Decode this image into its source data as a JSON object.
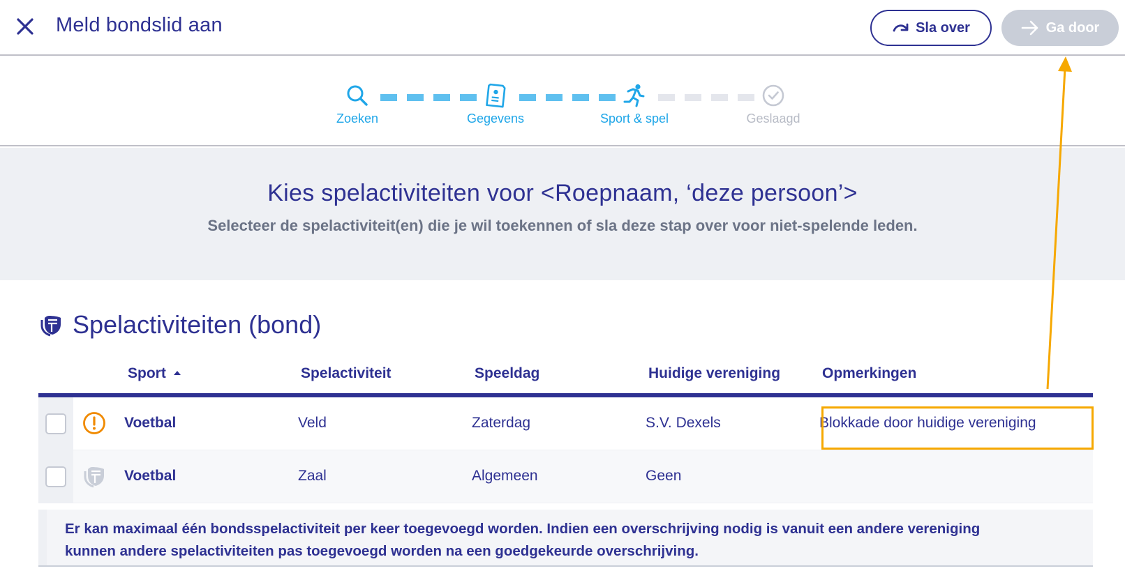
{
  "header": {
    "title": "Meld bondslid aan",
    "skip_label": "Sla over",
    "next_label": "Ga door"
  },
  "stepper": {
    "steps": [
      {
        "label": "Zoeken",
        "state": "done",
        "icon": "search-icon"
      },
      {
        "label": "Gegevens",
        "state": "done",
        "icon": "document-icon"
      },
      {
        "label": "Sport & spel",
        "state": "active",
        "icon": "running-icon"
      },
      {
        "label": "Geslaagd",
        "state": "todo",
        "icon": "check-circle-icon"
      }
    ]
  },
  "intro": {
    "heading": "Kies spelactiviteiten voor <Roepnaam, ‘deze persoon’>",
    "subheading": "Selecteer de spelactiviteit(en) die je wil toekennen of sla deze stap over voor niet-spelende leden."
  },
  "section": {
    "title": "Spelactiviteiten (bond)",
    "icon": "shield-icon"
  },
  "table": {
    "columns": [
      "Sport",
      "Spelactiviteit",
      "Speeldag",
      "Huidige vereniging",
      "Opmerkingen"
    ],
    "sort_column": "Sport",
    "rows": [
      {
        "status_icon": "warning-icon",
        "sport": "Voetbal",
        "activiteit": "Veld",
        "speeldag": "Zaterdag",
        "vereniging": "S.V. Dexels",
        "opmerking": "Blokkade door huidige vereniging"
      },
      {
        "status_icon": "shield-icon",
        "sport": "Voetbal",
        "activiteit": "Zaal",
        "speeldag": "Algemeen",
        "vereniging": "Geen",
        "opmerking": ""
      }
    ]
  },
  "note": {
    "line1": "Er kan maximaal één bondsspelactiviteit per keer toegevoegd worden. Indien een overschrijving nodig is vanuit een andere vereniging",
    "line2": "kunnen andere spelactiviteiten pas toegevoegd worden na een goedgekeurde overschrijving."
  },
  "colors": {
    "primary": "#2e3192",
    "step_active": "#1fa6e8",
    "step_done_dash": "#5fc0ef",
    "annotation": "#f6a800",
    "warning": "#f08a00",
    "disabled": "#c9ced8"
  }
}
